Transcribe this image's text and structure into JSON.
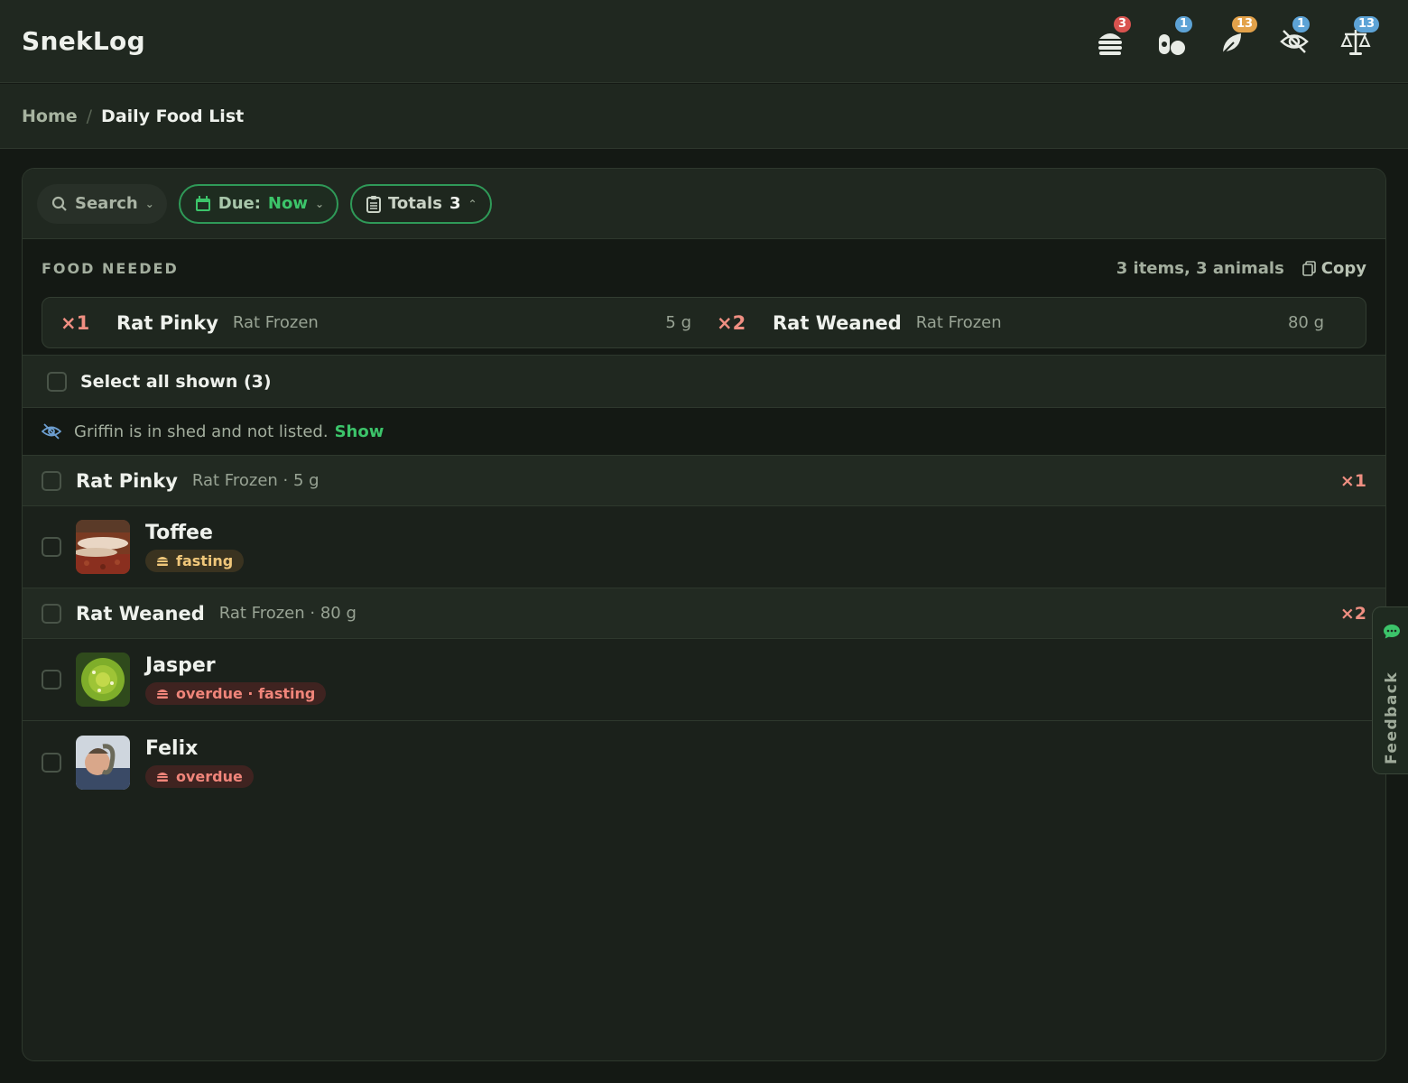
{
  "app": {
    "title": "SnekLog"
  },
  "header_icons": [
    {
      "name": "feeding-icon",
      "badge": "3",
      "badge_color": "#d9534f"
    },
    {
      "name": "poop-icon",
      "badge": "1",
      "badge_color": "#5da3d6"
    },
    {
      "name": "leaf-icon",
      "badge": "13",
      "badge_color": "#e3a24a"
    },
    {
      "name": "shed-hidden-icon",
      "badge": "1",
      "badge_color": "#5da3d6"
    },
    {
      "name": "scale-icon",
      "badge": "13",
      "badge_color": "#5da3d6"
    }
  ],
  "breadcrumb": {
    "home": "Home",
    "separator": "/",
    "current": "Daily Food List"
  },
  "filters": {
    "search": "Search",
    "due_label": "Due:",
    "due_value": "Now",
    "totals_label": "Totals",
    "totals_value": "3"
  },
  "food_needed": {
    "label": "FOOD NEEDED",
    "summary": "3 items, 3 animals",
    "copy_label": "Copy",
    "items": [
      {
        "qty": "×1",
        "name": "Rat Pinky",
        "type": "Rat Frozen",
        "weight": "5 g"
      },
      {
        "qty": "×2",
        "name": "Rat Weaned",
        "type": "Rat Frozen",
        "weight": "80 g"
      }
    ]
  },
  "select_all": "Select all shown (3)",
  "shed_note": {
    "text": "Griffin is in shed and not listed.",
    "link": "Show"
  },
  "groups": [
    {
      "name": "Rat Pinky",
      "sub": "Rat Frozen · 5 g",
      "qty": "×1",
      "animals": [
        {
          "name": "Toffee",
          "tag": "fasting",
          "tag_kind": "fasting"
        }
      ]
    },
    {
      "name": "Rat Weaned",
      "sub": "Rat Frozen · 80 g",
      "qty": "×2",
      "animals": [
        {
          "name": "Jasper",
          "tag": "overdue · fasting",
          "tag_kind": "overdue"
        },
        {
          "name": "Felix",
          "tag": "overdue",
          "tag_kind": "overdue"
        }
      ]
    }
  ],
  "feedback": {
    "label": "Feedback"
  },
  "colors": {
    "accent": "#3cc46a",
    "qty": "#ef8f82",
    "background": "#141914"
  }
}
